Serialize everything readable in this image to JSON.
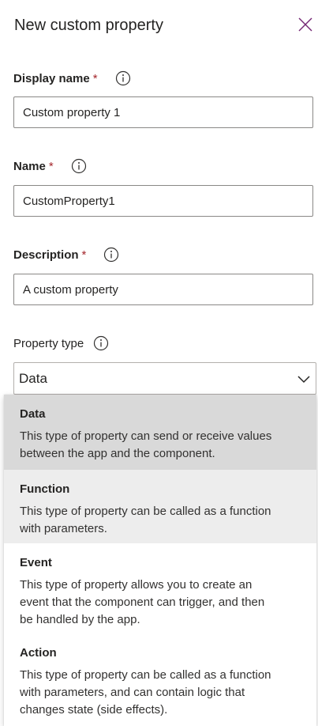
{
  "panel": {
    "title": "New custom property"
  },
  "fields": {
    "display_name": {
      "label": "Display name",
      "required": "*",
      "value": "Custom property 1"
    },
    "name": {
      "label": "Name",
      "required": "*",
      "value": "CustomProperty1"
    },
    "description": {
      "label": "Description",
      "required": "*",
      "value": "A custom property"
    },
    "property_type": {
      "label": "Property type",
      "selected": "Data"
    }
  },
  "options": [
    {
      "title": "Data",
      "description": "This type of property can send or receive values\nbetween the app and the component."
    },
    {
      "title": "Function",
      "description": "This type of property can be called as a function\nwith parameters."
    },
    {
      "title": "Event",
      "description": "This type of property allows you to create an\nevent that the component can trigger, and then\nbe handled by the app."
    },
    {
      "title": "Action",
      "description": "This type of property can be called as a function\nwith parameters, and can contain logic that\nchanges state (side effects)."
    }
  ],
  "icons": {
    "close": "close-icon",
    "info": "info-icon",
    "chevron": "chevron-down-icon"
  },
  "colors": {
    "required": "#a4262c",
    "selected_option_bg": "#d9d9d9",
    "hover_option_bg": "#ededed",
    "close_icon": "#742774"
  }
}
